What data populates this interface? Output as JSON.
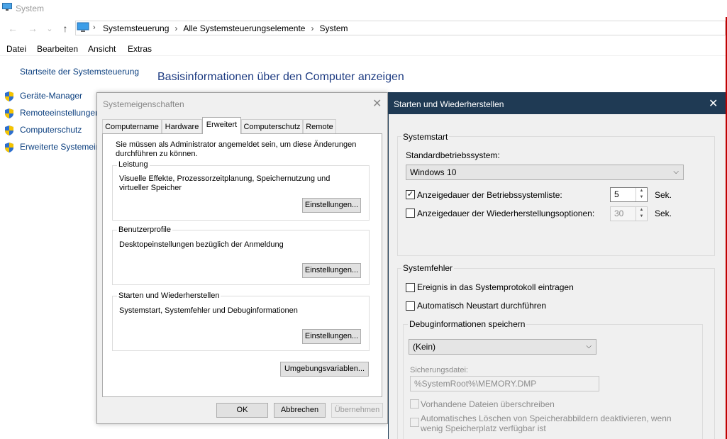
{
  "window": {
    "title": "System",
    "breadcrumb": [
      "Systemsteuerung",
      "Alle Systemsteuerungselemente",
      "System"
    ],
    "menu": [
      "Datei",
      "Bearbeiten",
      "Ansicht",
      "Extras"
    ],
    "nav": {
      "back": "←",
      "forward": "→",
      "dropdown": "⌄",
      "up": "↑"
    }
  },
  "sidebar": {
    "home_link": "Startseite der Systemsteuerung",
    "items": [
      {
        "label": "Geräte-Manager"
      },
      {
        "label": "Remoteeinstellungen"
      },
      {
        "label": "Computerschutz"
      },
      {
        "label": "Erweiterte Systemeinstellungen"
      }
    ]
  },
  "main": {
    "title": "Basisinformationen über den Computer anzeigen"
  },
  "sysprops": {
    "title": "Systemeigenschaften",
    "close": "✕",
    "tabs": [
      "Computername",
      "Hardware",
      "Erweitert",
      "Computerschutz",
      "Remote"
    ],
    "active_tab": "Erweitert",
    "admin_note": "Sie müssen als Administrator angemeldet sein, um diese Änderungen durchführen zu können.",
    "groups": [
      {
        "label": "Leistung",
        "text": "Visuelle Effekte, Prozessorzeitplanung, Speichernutzung und virtueller Speicher",
        "button": "Einstellungen..."
      },
      {
        "label": "Benutzerprofile",
        "text": "Desktopeinstellungen bezüglich der Anmeldung",
        "button": "Einstellungen..."
      },
      {
        "label": "Starten und Wiederherstellen",
        "text": "Systemstart, Systemfehler und Debuginformationen",
        "button": "Einstellungen..."
      }
    ],
    "env_button": "Umgebungsvariablen...",
    "ok": "OK",
    "cancel": "Abbrechen",
    "apply": "Übernehmen"
  },
  "startup": {
    "title": "Starten und Wiederherstellen",
    "close": "✕",
    "systemstart": {
      "label": "Systemstart",
      "default_os_label": "Standardbetriebssystem:",
      "default_os_value": "Windows 10",
      "os_list_label": "Anzeigedauer der Betriebssystemliste:",
      "os_list_checked": true,
      "os_list_value": "5",
      "recovery_label": "Anzeigedauer der Wiederherstellungsoptionen:",
      "recovery_checked": false,
      "recovery_value": "30",
      "unit": "Sek."
    },
    "systemfehler": {
      "label": "Systemfehler",
      "log_label": "Ereignis in das Systemprotokoll eintragen",
      "log_checked": false,
      "restart_label": "Automatisch Neustart durchführen",
      "restart_checked": false,
      "debug": {
        "label": "Debuginformationen speichern",
        "value": "(Kein)",
        "dumpfile_label": "Sicherungsdatei:",
        "dumpfile_value": "%SystemRoot%\\MEMORY.DMP",
        "overwrite_label": "Vorhandene Dateien überschreiben",
        "autodelete_label": "Automatisches Löschen von Speicherabbildern deaktivieren, wenn wenig Speicherplatz verfügbar ist"
      }
    }
  },
  "colors": {
    "link": "#0b3f7f",
    "title_blue": "#1e3c82",
    "dialog_titlebar": "#1f3a54",
    "window_edge": "#c00000"
  }
}
